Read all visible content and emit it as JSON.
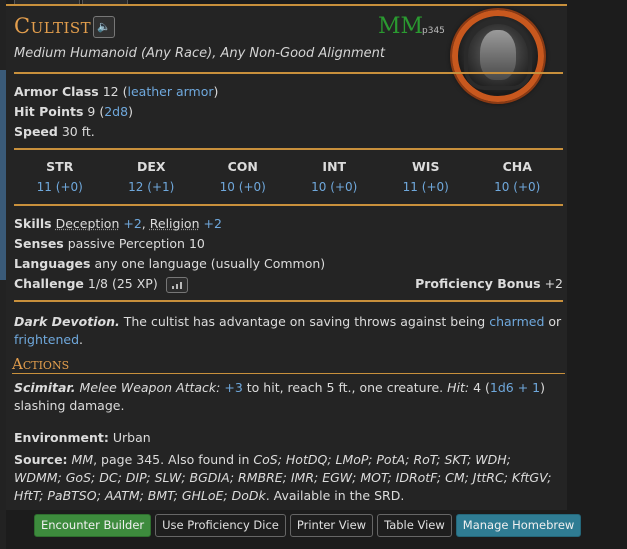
{
  "monster": {
    "name": "Cultist",
    "source_abbr": "MM",
    "source_page": "p345",
    "subtitle": "Medium Humanoid (Any Race), Any Non-Good Alignment",
    "armor_class_label": "Armor Class",
    "armor_class_value": "12",
    "armor_class_link": "leather armor",
    "hit_points_label": "Hit Points",
    "hit_points_value": "9",
    "hit_points_link": "2d8",
    "speed_label": "Speed",
    "speed_value": "30 ft.",
    "abilities": [
      {
        "label": "STR",
        "value": "11 (+0)"
      },
      {
        "label": "DEX",
        "value": "12 (+1)"
      },
      {
        "label": "CON",
        "value": "10 (+0)"
      },
      {
        "label": "INT",
        "value": "10 (+0)"
      },
      {
        "label": "WIS",
        "value": "11 (+0)"
      },
      {
        "label": "CHA",
        "value": "10 (+0)"
      }
    ],
    "skills_label": "Skills",
    "skills": [
      {
        "name": "Deception",
        "bonus": "+2"
      },
      {
        "name": "Religion",
        "bonus": "+2"
      }
    ],
    "senses_label": "Senses",
    "senses_value": "passive Perception 10",
    "languages_label": "Languages",
    "languages_value": "any one language (usually Common)",
    "challenge_label": "Challenge",
    "challenge_value": "1/8 (25 XP)",
    "proficiency_label": "Proficiency Bonus",
    "proficiency_value": "+2",
    "trait": {
      "name": "Dark Devotion.",
      "text_before": "The cultist has advantage on saving throws against being",
      "link1": "charmed",
      "text_mid": "or",
      "link2": "frightened",
      "text_after": "."
    },
    "actions_title": "Actions",
    "action": {
      "name": "Scimitar.",
      "type": "Melee Weapon Attack:",
      "to_hit": "+3",
      "text1": "to hit, reach 5 ft., one creature.",
      "hit_label": "Hit:",
      "damage_avg": "4 (",
      "damage_dice": "1d6 + 1",
      "damage_rest": ") slashing damage."
    },
    "environment_label": "Environment:",
    "environment_value": "Urban",
    "source_label": "Source:",
    "source_text_1": "MM",
    "source_text_2": ", page 345. Also found in",
    "source_books_line1": "CoS; HotDQ; LMoP; PotA; RoT; SKT; WDH; WDMM; GoS;",
    "source_books_line2": "DC; DIP; SLW; BGDIA; RMBRE; IMR; EGW; MOT; IDRotF; CM; JttRC; KftGV; HftT; PaBTSO;",
    "source_books_line3": "AATM; BMT; GHLoE; DoDk",
    "source_suffix": ". Available in the SRD."
  },
  "footer": {
    "encounter_builder": "Encounter Builder",
    "use_proficiency_dice": "Use Proficiency Dice",
    "printer_view": "Printer View",
    "table_view": "Table View",
    "manage_homebrew": "Manage Homebrew"
  },
  "colors": {
    "accent": "#c8903c",
    "title": "#e39e4d",
    "link": "#6fa8dc",
    "source_green": "#2a9a30",
    "btn_green": "#3d8b3d",
    "btn_teal": "#2f7c93"
  },
  "icons": {
    "sound": "speaker-icon",
    "challenge": "bar-chart-icon"
  }
}
